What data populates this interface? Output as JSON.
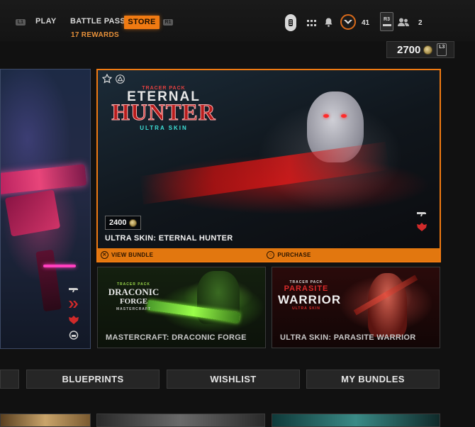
{
  "top_nav": {
    "left_bumper": "L1",
    "tabs": [
      {
        "label": "PLAY"
      },
      {
        "label": "BATTLE PASS",
        "sub": "17 REWARDS"
      },
      {
        "label": "STORE"
      }
    ],
    "right_bumper": "R1",
    "level": "41",
    "r3_label": "R3",
    "party_count": "2"
  },
  "currency": {
    "amount": "2700",
    "button": "L3"
  },
  "featured": {
    "logo_top": "TRACER PACK",
    "logo_line1": "ETERNAL",
    "logo_line2": "HUNTER",
    "logo_line3": "ULTRA SKIN",
    "price": "2400",
    "title": "ULTRA SKIN: ETERNAL HUNTER",
    "actions": [
      {
        "glyph": "✕",
        "label": "VIEW BUNDLE"
      },
      {
        "glyph": "○",
        "label": "PURCHASE"
      }
    ]
  },
  "tiles": [
    {
      "title": "MASTERCRAFT: DRACONIC FORGE",
      "logo_top": "TRACER PACK",
      "logo_main": "DRACONIC",
      "logo_sub": "FORGE",
      "logo_tag": "MASTERCRAFT"
    },
    {
      "title": "ULTRA SKIN: PARASITE WARRIOR",
      "logo_top": "TRACER PACK",
      "logo_main": "PARASITE",
      "logo_sub": "WARRIOR",
      "logo_tag": "ULTRA SKIN"
    }
  ],
  "bottom_tabs": [
    {
      "label": "BLUEPRINTS"
    },
    {
      "label": "WISHLIST"
    },
    {
      "label": "MY BUNDLES"
    }
  ],
  "colors": {
    "accent": "#f07a12",
    "accent_dark": "#e2770f",
    "rewards": "#e8913a"
  }
}
